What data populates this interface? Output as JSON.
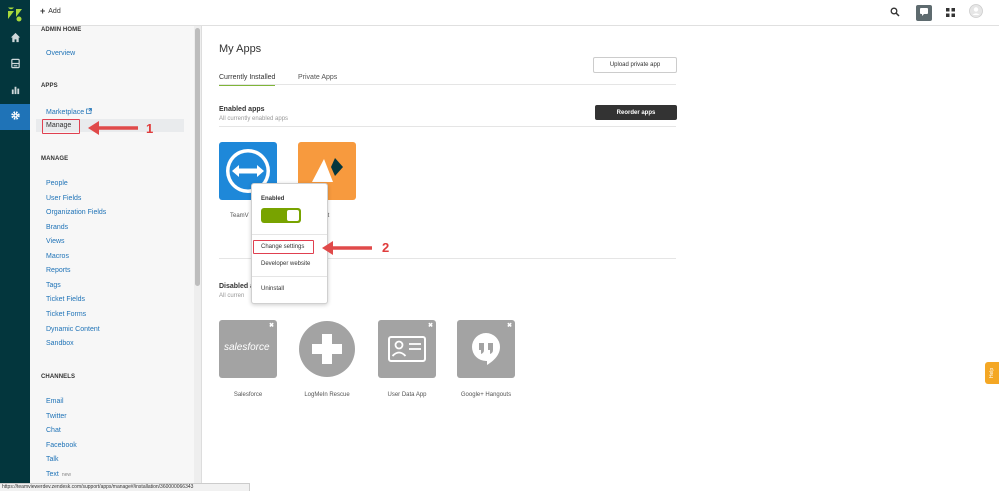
{
  "header": {
    "add_label": "Add"
  },
  "sidebar": {
    "admin_home_heading": "ADMIN HOME",
    "overview": "Overview",
    "apps_heading": "APPS",
    "marketplace": "Marketplace",
    "manage_item": "Manage",
    "manage_heading": "MANAGE",
    "manage_items": [
      "People",
      "User Fields",
      "Organization Fields",
      "Brands",
      "Views",
      "Macros",
      "Reports",
      "Tags",
      "Ticket Fields",
      "Ticket Forms",
      "Dynamic Content",
      "Sandbox"
    ],
    "channels_heading": "CHANNELS",
    "channel_items": [
      "Email",
      "Twitter",
      "Chat",
      "Facebook",
      "Talk",
      "Text"
    ],
    "new_tag": "new"
  },
  "main": {
    "title": "My Apps",
    "tabs": [
      "Currently Installed",
      "Private Apps"
    ],
    "upload_button": "Upload private app",
    "reorder_button": "Reorder apps",
    "enabled_heading": "Enabled apps",
    "enabled_sub": "All currently enabled apps",
    "disabled_heading": "Disabled a",
    "disabled_sub": "All curren",
    "enabled_apps": [
      {
        "label": "TeamV",
        "color": "#1e88d9"
      },
      {
        "label": "k Chat",
        "color": "#f79a3e"
      }
    ],
    "disabled_apps": [
      {
        "label": "Salesforce",
        "tile_text": "salesforce"
      },
      {
        "label": "LogMeIn Rescue"
      },
      {
        "label": "User Data App"
      },
      {
        "label": "Google+ Hangouts"
      }
    ]
  },
  "dropdown": {
    "enabled_label": "Enabled",
    "enabled": true,
    "items": [
      "Change settings",
      "Developer website",
      "Uninstall"
    ]
  },
  "annotations": {
    "step1": "1",
    "step2": "2"
  },
  "help_tab": "Help",
  "status_url": "https://teamviewerdev.zendesk.com/support/apps/manage#/installation/360000066343",
  "colors": {
    "rail": "#03363d",
    "active_nav": "#1f73b7",
    "link": "#1f73b7",
    "toggle": "#78a300",
    "annotation": "#e03c3c",
    "help": "#f4a724"
  }
}
